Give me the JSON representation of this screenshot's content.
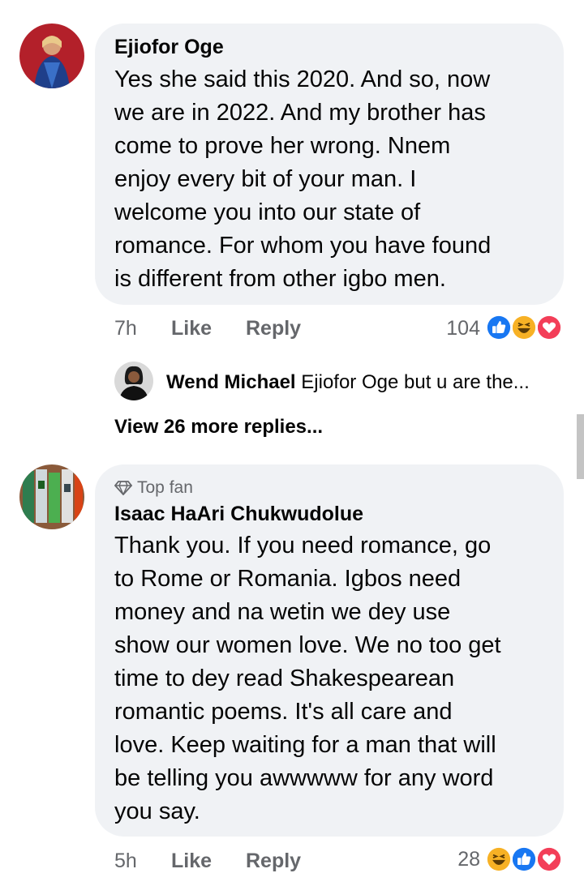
{
  "comments": [
    {
      "author": "Ejiofor Oge",
      "lines": [
        "Yes she said this 2020. And so, now",
        "we are in 2022. And my brother has",
        "come to prove  her wrong. Nnem",
        "enjoy every bit of your man. I",
        "welcome you into our state of",
        "romance.  For whom you have found",
        "is different from other igbo men."
      ],
      "time": "7h",
      "like_label": "Like",
      "reply_label": "Reply",
      "reaction_count": "104",
      "reactions": [
        "like-icon",
        "haha-icon",
        "love-icon"
      ]
    },
    {
      "badge": "Top fan",
      "author": "Isaac HaAri Chukwudolue",
      "lines": [
        "Thank you. If you need romance, go",
        "to  Rome or Romania. Igbos need",
        "money and na wetin we dey use",
        "show our women love.  We no too get",
        "time to dey read Shakespearean",
        "romantic poems. It's all care and",
        "love. Keep waiting for a man that will",
        "be telling you awwwww for any word",
        "you say."
      ],
      "time": "5h",
      "like_label": "Like",
      "reply_label": "Reply",
      "reaction_count": "28",
      "reactions": [
        "haha-icon",
        "like-icon",
        "love-icon"
      ]
    }
  ],
  "reply_preview": {
    "author": "Wend Michael",
    "text": "Ejiofor Oge but u are the..."
  },
  "view_more_label": "View 26 more replies...",
  "colors": {
    "bubble": "#f0f2f5",
    "meta_text": "#65676b",
    "like_blue": "#1877f2",
    "love_red": "#f33e58",
    "haha_yellow": "#f7b125"
  }
}
